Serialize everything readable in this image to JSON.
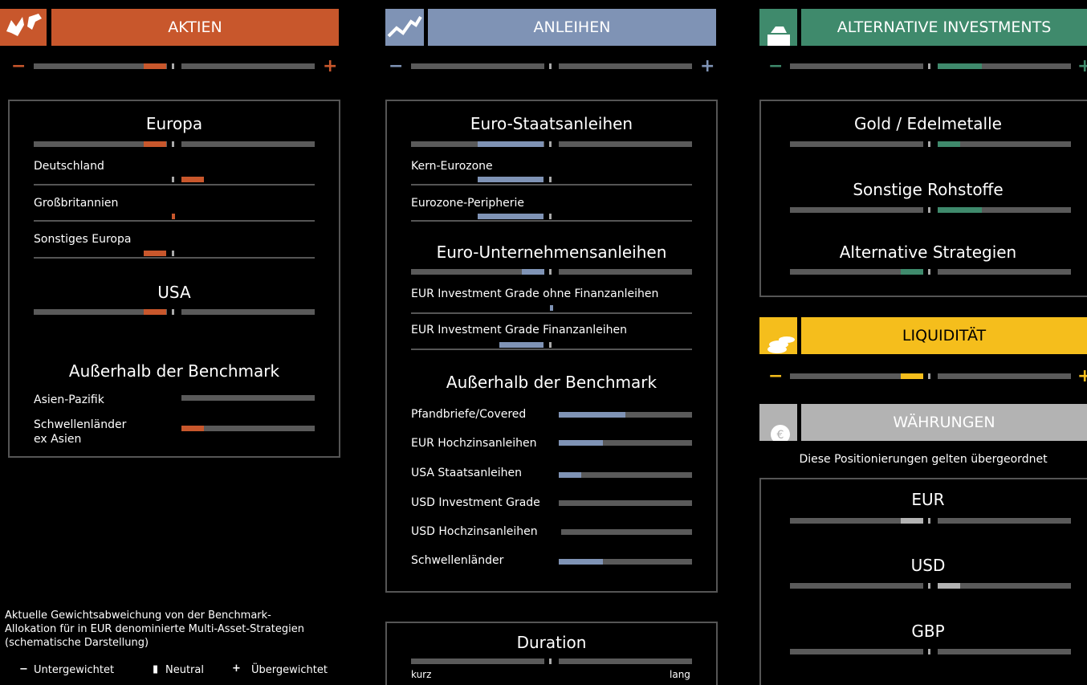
{
  "colors": {
    "aktien": "#c8572c",
    "anleihen": "#7f93b5",
    "alternative": "#3f8a6c",
    "liquiditaet": "#f5be1c",
    "waehrungen": "#b3b3b3",
    "track": "#5a5a5a"
  },
  "aktien": {
    "header": "AKTIEN",
    "overall_minus": "−",
    "overall_plus": "+",
    "europa": {
      "title": "Europa",
      "rows": [
        {
          "label": "Deutschland"
        },
        {
          "label": "Großbritannien"
        },
        {
          "label": "Sonstiges Europa"
        }
      ]
    },
    "usa": {
      "title": "USA"
    },
    "ausserhalb": {
      "title": "Außerhalb der Benchmark",
      "rows": [
        {
          "label": "Asien-Pazifik"
        },
        {
          "label": "Schwellenländer\nex Asien"
        }
      ]
    }
  },
  "anleihen": {
    "header": "ANLEIHEN",
    "overall_minus": "−",
    "overall_plus": "+",
    "staat": {
      "title": "Euro-Staatsanleihen",
      "rows": [
        {
          "label": "Kern-Eurozone"
        },
        {
          "label": "Eurozone-Peripherie"
        }
      ]
    },
    "unternehmen": {
      "title": "Euro-Unternehmensanleihen",
      "rows": [
        {
          "label": "EUR Investment Grade ohne Finanzanleihen"
        },
        {
          "label": "EUR Investment Grade Finanzanleihen"
        }
      ]
    },
    "ausserhalb": {
      "title": "Außerhalb der Benchmark",
      "rows": [
        {
          "label": "Pfandbriefe/Covered"
        },
        {
          "label": "EUR Hochzinsanleihen"
        },
        {
          "label": "USA Staatsanleihen"
        },
        {
          "label": "USD Investment Grade"
        },
        {
          "label": "USD Hochzinsanleihen"
        },
        {
          "label": "Schwellenländer"
        }
      ]
    },
    "duration": {
      "title": "Duration",
      "left": "kurz",
      "right": "lang"
    }
  },
  "alternative": {
    "header": "ALTERNATIVE INVESTMENTS",
    "overall_minus": "−",
    "overall_plus": "+",
    "rows": [
      {
        "title": "Gold / Edelmetalle"
      },
      {
        "title": "Sonstige Rohstoffe"
      },
      {
        "title": "Alternative Strategien"
      }
    ]
  },
  "liquiditaet": {
    "header": "LIQUIDITÄT",
    "overall_minus": "−",
    "overall_plus": "+"
  },
  "waehrungen": {
    "header": "WÄHRUNGEN",
    "note": "Diese Positionierungen gelten übergeordnet",
    "rows": [
      {
        "title": "EUR"
      },
      {
        "title": "USD"
      },
      {
        "title": "GBP"
      }
    ]
  },
  "legend": {
    "text": "Aktuelle Gewichtsabweichung von der Benchmark-\nAllokation für in EUR denominierte Multi-Asset-Strategien\n(schematische Darstellung)",
    "minus_symbol": "−",
    "minus": "Untergewichtet",
    "neutral_symbol": "▮",
    "neutral": "Neutral",
    "plus_symbol": "+",
    "plus": "Übergewichtet"
  }
}
